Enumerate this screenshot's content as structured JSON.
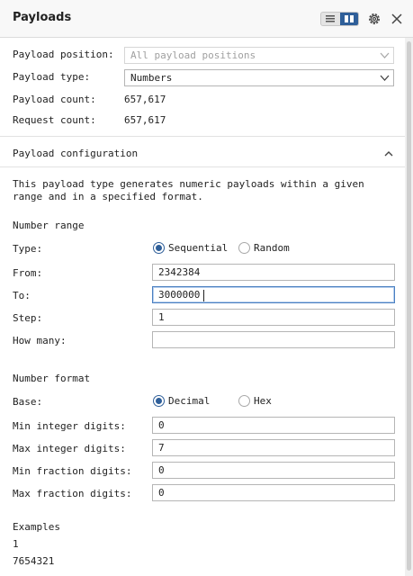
{
  "header": {
    "title": "Payloads"
  },
  "payload": {
    "position_label": "Payload position:",
    "position_value": "All payload positions",
    "type_label": "Payload type:",
    "type_value": "Numbers",
    "count_label": "Payload count:",
    "count_value": "657,617",
    "request_label": "Request count:",
    "request_value": "657,617"
  },
  "config": {
    "title": "Payload configuration",
    "description": "This payload type generates numeric payloads within a given range and in a specified format.",
    "number_range": {
      "heading": "Number range",
      "type_label": "Type:",
      "type_options": [
        "Sequential",
        "Random"
      ],
      "type_selected": "Sequential",
      "from_label": "From:",
      "from_value": "2342384",
      "to_label": "To:",
      "to_value": "3000000",
      "step_label": "Step:",
      "step_value": "1",
      "how_many_label": "How many:",
      "how_many_value": ""
    },
    "number_format": {
      "heading": "Number format",
      "base_label": "Base:",
      "base_options": [
        "Decimal",
        "Hex"
      ],
      "base_selected": "Decimal",
      "min_int_label": "Min integer digits:",
      "min_int_value": "0",
      "max_int_label": "Max integer digits:",
      "max_int_value": "7",
      "min_frac_label": "Min fraction digits:",
      "min_frac_value": "0",
      "max_frac_label": "Max fraction digits:",
      "max_frac_value": "0"
    },
    "examples": {
      "heading": "Examples",
      "items": [
        "1",
        "7654321"
      ]
    }
  },
  "colors": {
    "accent": "#2f5f99",
    "focus_border": "#4a7fc1"
  }
}
